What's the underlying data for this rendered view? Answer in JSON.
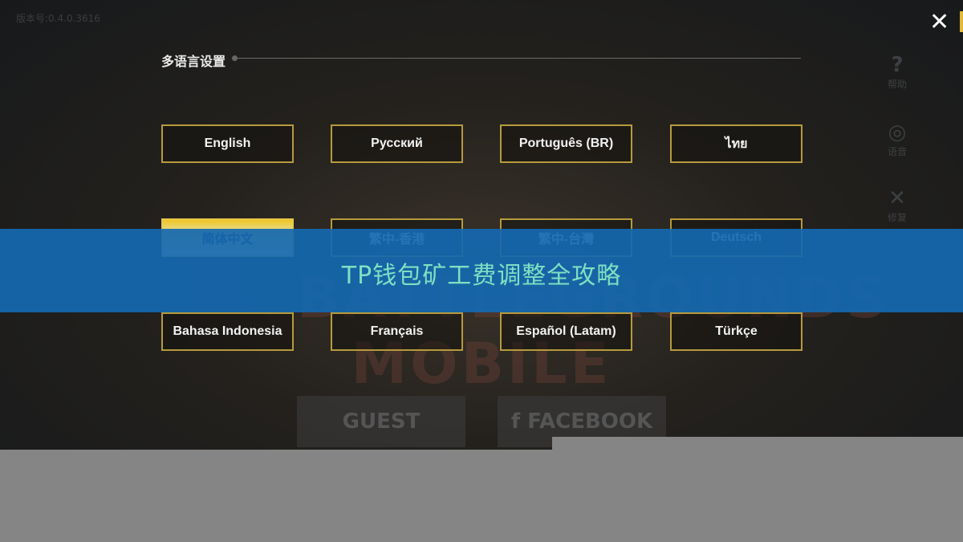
{
  "version_text": "版本号:0.4.0.3616",
  "dialog": {
    "title": "多语言设置",
    "close_icon": "close-icon"
  },
  "sidebar": [
    {
      "icon": "?",
      "label": "帮助"
    },
    {
      "icon": "◎",
      "label": "语音"
    },
    {
      "icon": "✕",
      "label": "修复"
    }
  ],
  "languages": [
    {
      "label": "English",
      "selected": false
    },
    {
      "label": "Русский",
      "selected": false
    },
    {
      "label": "Português (BR)",
      "selected": false
    },
    {
      "label": "ไทย",
      "selected": false
    },
    {
      "label": "简体中文",
      "selected": true
    },
    {
      "label": "繁中-香港",
      "selected": false
    },
    {
      "label": "繁中-台灣",
      "selected": false
    },
    {
      "label": "Deutsch",
      "selected": false
    },
    {
      "label": "Bahasa Indonesia",
      "selected": false
    },
    {
      "label": "Français",
      "selected": false
    },
    {
      "label": "Español (Latam)",
      "selected": false
    },
    {
      "label": "Türkçe",
      "selected": false
    }
  ],
  "background": {
    "logo_text": "BATTLEGROUNDS MOBILE",
    "guest_label": "GUEST",
    "facebook_label": "f FACEBOOK"
  },
  "banner": {
    "text": "TP钱包矿工费调整全攻略",
    "color": "#1568b0",
    "text_color": "#7de0c2"
  }
}
